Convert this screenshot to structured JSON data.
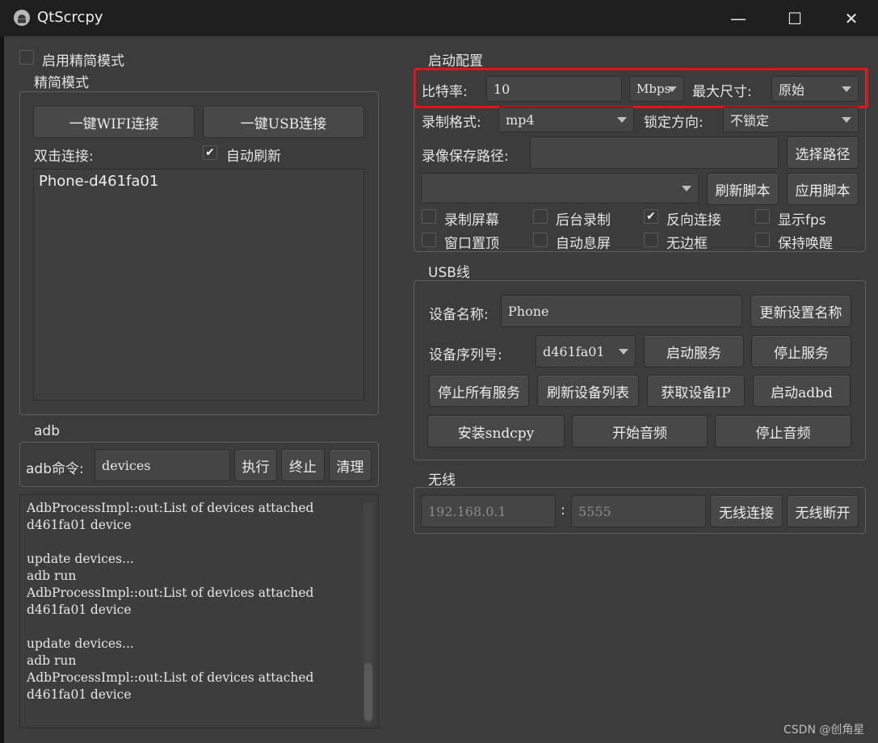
{
  "window": {
    "title": "QtScrcpy",
    "minimize_glyph": "—",
    "maximize_glyph": "☐",
    "close_glyph": "✕"
  },
  "simple_mode": {
    "enable_label": "启用精简模式",
    "enabled": false,
    "group_title": "精简模式",
    "wifi_button": "一键WIFI连接",
    "usb_button": "一键USB连接",
    "double_click_label": "双击连接:",
    "auto_refresh_label": "自动刷新",
    "auto_refresh_checked": true,
    "devices": [
      "Phone-d461fa01"
    ]
  },
  "adb": {
    "group_title": "adb",
    "command_label": "adb命令:",
    "command_value": "devices",
    "execute_button": "执行",
    "stop_button": "终止",
    "clear_button": "清理",
    "log_lines": [
      "AdbProcessImpl::out:List of devices attached",
      "d461fa01\tdevice",
      "",
      "update devices...",
      "adb run",
      "AdbProcessImpl::out:List of devices attached",
      "d461fa01\tdevice",
      "",
      "update devices...",
      "adb run",
      "AdbProcessImpl::out:List of devices attached",
      "d461fa01\tdevice"
    ]
  },
  "start_config": {
    "group_title": "启动配置",
    "bitrate_label": "比特率:",
    "bitrate_value": "10",
    "bitrate_unit": "Mbps",
    "max_size_label": "最大尺寸:",
    "max_size_value": "原始",
    "record_format_label": "录制格式:",
    "record_format_value": "mp4",
    "lock_orientation_label": "锁定方向:",
    "lock_orientation_value": "不锁定",
    "record_path_label": "录像保存路径:",
    "record_path_value": "",
    "select_path_button": "选择路径",
    "script_value": "",
    "refresh_script_button": "刷新脚本",
    "apply_script_button": "应用脚本",
    "checkboxes": [
      {
        "label": "录制屏幕",
        "checked": false
      },
      {
        "label": "后台录制",
        "checked": false
      },
      {
        "label": "反向连接",
        "checked": true
      },
      {
        "label": "显示fps",
        "checked": false
      },
      {
        "label": "窗口置顶",
        "checked": false
      },
      {
        "label": "自动息屏",
        "checked": false
      },
      {
        "label": "无边框",
        "checked": false
      },
      {
        "label": "保持唤醒",
        "checked": false
      }
    ]
  },
  "usb": {
    "group_title": "USB线",
    "device_name_label": "设备名称:",
    "device_name_value": "Phone",
    "update_name_button": "更新设置名称",
    "serial_label": "设备序列号:",
    "serial_value": "d461fa01",
    "start_service_button": "启动服务",
    "stop_service_button": "停止服务",
    "stop_all_button": "停止所有服务",
    "refresh_devices_button": "刷新设备列表",
    "get_ip_button": "获取设备IP",
    "start_adbd_button": "启动adbd",
    "install_sndcpy_button": "安装sndcpy",
    "start_audio_button": "开始音频",
    "stop_audio_button": "停止音频"
  },
  "wireless": {
    "group_title": "无线",
    "ip_placeholder": "192.168.0.1",
    "separator": ":",
    "port_placeholder": "5555",
    "connect_button": "无线连接",
    "disconnect_button": "无线断开"
  },
  "watermark": "CSDN @创角星",
  "colors": {
    "window_bg": "#3c3c3c",
    "highlight_border": "#e0161b"
  }
}
